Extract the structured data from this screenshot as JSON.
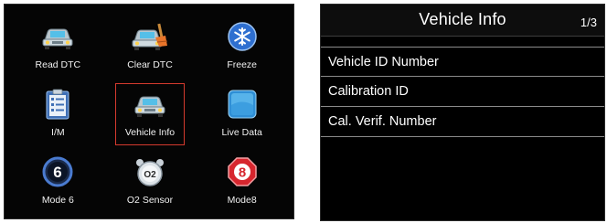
{
  "left_screen": {
    "menu": [
      {
        "label": "Read DTC",
        "icon": "car-icon"
      },
      {
        "label": "Clear DTC",
        "icon": "car-brush-icon"
      },
      {
        "label": "Freeze",
        "icon": "snowflake-icon"
      },
      {
        "label": "I/M",
        "icon": "checklist-icon"
      },
      {
        "label": "Vehicle Info",
        "icon": "car-icon",
        "selected": true
      },
      {
        "label": "Live Data",
        "icon": "live-data-icon"
      },
      {
        "label": "Mode 6",
        "icon": "mode6-icon",
        "badge": "6"
      },
      {
        "label": "O2 Sensor",
        "icon": "o2-sensor-icon",
        "badge": "O2"
      },
      {
        "label": "Mode8",
        "icon": "mode8-icon",
        "badge": "8"
      }
    ],
    "selection_color": "#d43a2e"
  },
  "right_screen": {
    "title": "Vehicle Info",
    "page": "1/3",
    "items": [
      {
        "label": "Vehicle ID Number"
      },
      {
        "label": "Calibration ID"
      },
      {
        "label": "Cal. Verif. Number"
      }
    ]
  }
}
